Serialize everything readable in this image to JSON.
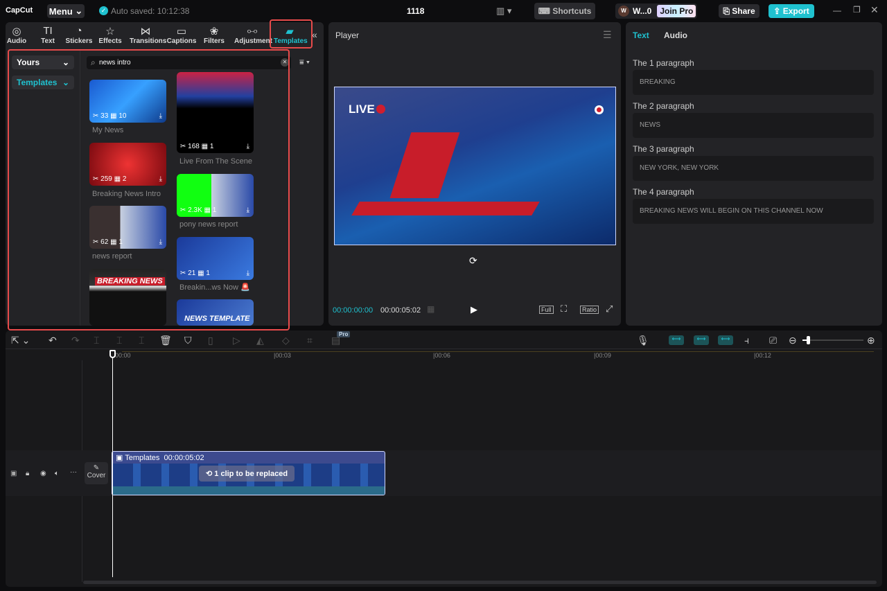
{
  "app": {
    "logo": "CapCut",
    "menu": "Menu",
    "autosave": "Auto saved: 10:12:38",
    "project_title": "1118"
  },
  "topbar": {
    "shortcuts": "Shortcuts",
    "user_initial": "W",
    "user_name": "W...0",
    "join_pro": "Join Pro",
    "share": "Share",
    "export": "Export",
    "accent": "#1fc1cf"
  },
  "tools": [
    {
      "label": "Audio",
      "icon": "audio-icon"
    },
    {
      "label": "Text",
      "icon": "text-icon"
    },
    {
      "label": "Stickers",
      "icon": "sticker-icon"
    },
    {
      "label": "Effects",
      "icon": "effects-icon"
    },
    {
      "label": "Transitions",
      "icon": "transitions-icon"
    },
    {
      "label": "Captions",
      "icon": "captions-icon"
    },
    {
      "label": "Filters",
      "icon": "filters-icon"
    },
    {
      "label": "Adjustment",
      "icon": "adjustment-icon"
    },
    {
      "label": "Templates",
      "icon": "templates-icon",
      "active": true
    }
  ],
  "sidebar": {
    "yours": "Yours",
    "templates": "Templates"
  },
  "search": {
    "value": "news intro"
  },
  "templates": [
    {
      "title": "My News",
      "uses": "33",
      "clips": "10"
    },
    {
      "title": "Live From The Scene",
      "uses": "168",
      "clips": "1"
    },
    {
      "title": "Breaking News Intro",
      "uses": "259",
      "clips": "2"
    },
    {
      "title": "pony news report",
      "uses": "2.3K",
      "clips": "1"
    },
    {
      "title": "news report",
      "uses": "62",
      "clips": "1"
    },
    {
      "title": "Breakin...ws Now 🚨",
      "uses": "21",
      "clips": "1"
    },
    {
      "title": "",
      "thumb_text": "BREAKING NEWS"
    },
    {
      "title": "",
      "thumb_text": "NEWS TEMPLATE"
    }
  ],
  "player": {
    "title": "Player",
    "live": "LIVE",
    "current": "00:00:00:00",
    "duration": "00:00:05:02",
    "full": "Full",
    "ratio": "Ratio"
  },
  "right": {
    "tabs": [
      "Text",
      "Audio"
    ],
    "paragraphs": [
      {
        "label": "The 1 paragraph",
        "value": "BREAKING"
      },
      {
        "label": "The 2 paragraph",
        "value": "NEWS"
      },
      {
        "label": "The 3 paragraph",
        "value": "NEW YORK, NEW YORK"
      },
      {
        "label": "The 4 paragraph",
        "value": "BREAKING NEWS WILL BEGIN ON THIS CHANNEL NOW"
      }
    ]
  },
  "timeline": {
    "pro": "Pro",
    "ticks": [
      "00:00",
      "|00:03",
      "|00:06",
      "|00:09",
      "|00:12"
    ],
    "cover": "Cover",
    "clip_label": "Templates",
    "clip_duration": "00:00:05:02",
    "replace": "1 clip to be replaced"
  }
}
